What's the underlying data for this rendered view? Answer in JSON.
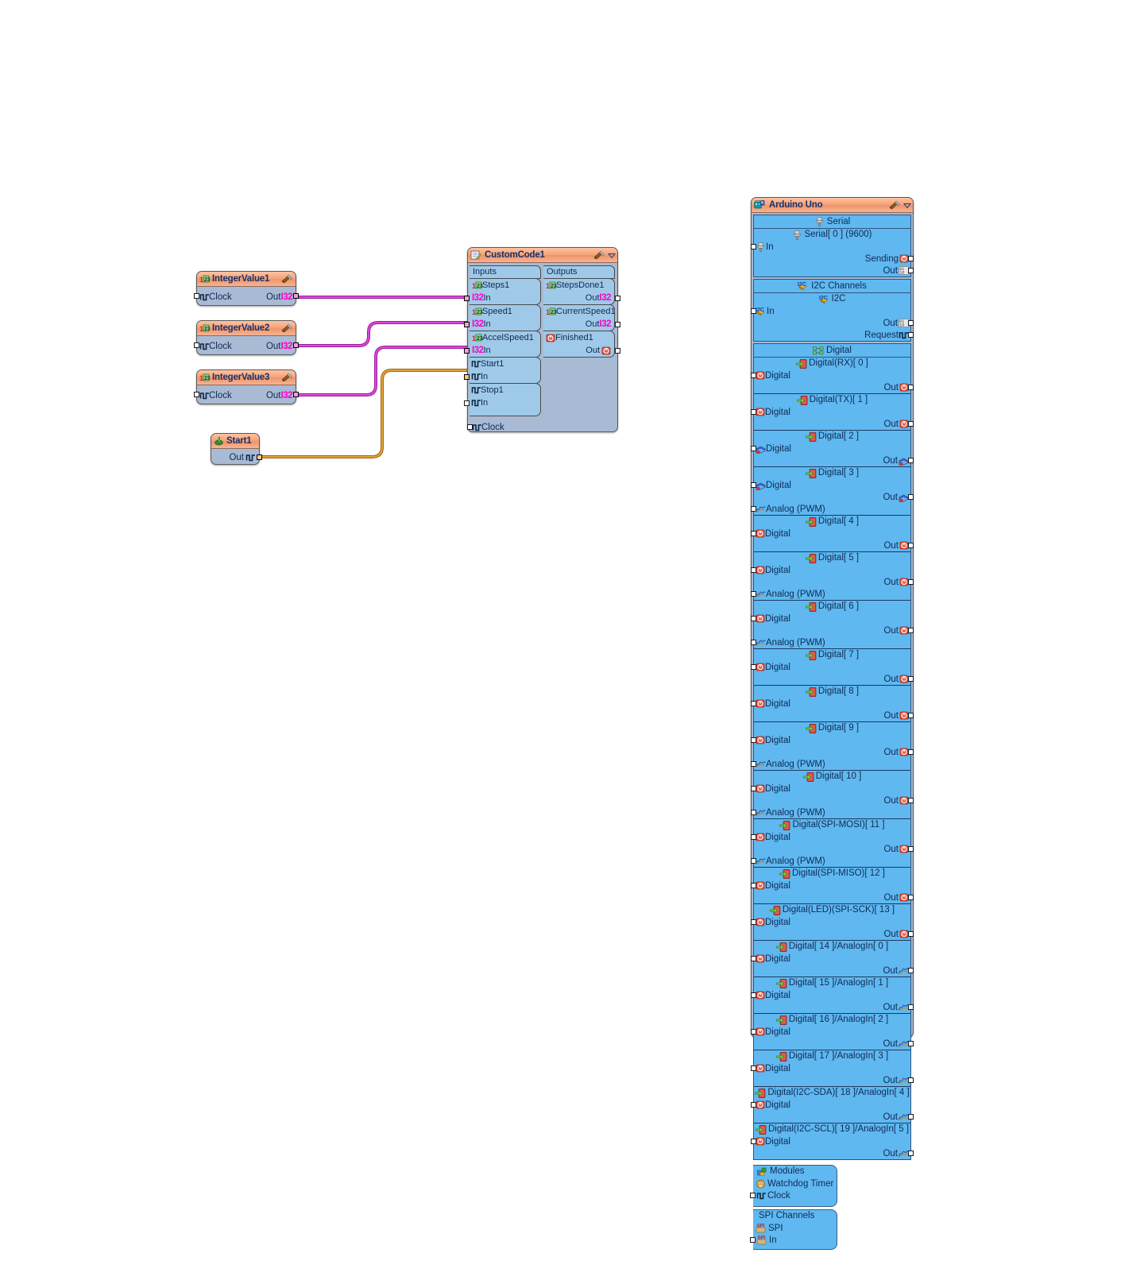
{
  "canvas": {
    "background": "#ffffff",
    "wire_color_data": "#cc2ecc",
    "wire_color_clock": "#c8860d"
  },
  "nodes": {
    "integer_values": [
      {
        "title": "IntegerValue1",
        "input_label": "Clock",
        "output_label": "Out",
        "output_type": "I32",
        "icon": "number-123-icon",
        "tool_icon": "wrench-icon"
      },
      {
        "title": "IntegerValue2",
        "input_label": "Clock",
        "output_label": "Out",
        "output_type": "I32",
        "icon": "number-123-icon",
        "tool_icon": "wrench-icon"
      },
      {
        "title": "IntegerValue3",
        "input_label": "Clock",
        "output_label": "Out",
        "output_type": "I32",
        "icon": "number-123-icon",
        "tool_icon": "wrench-icon"
      }
    ],
    "start": {
      "title": "Start1",
      "output_label": "Out",
      "icon": "start-icon"
    },
    "customcode": {
      "title": "CustomCode1",
      "title_icon": "code-edit-icon",
      "tool_icon": "wrench-icon",
      "menu_icon": "chevron-down-icon",
      "inputs_header": "Inputs",
      "outputs_header": "Outputs",
      "inputs": [
        {
          "name": "Steps1",
          "pin_label": "In",
          "type": "I32",
          "icon": "number-123-icon"
        },
        {
          "name": "Speed1",
          "pin_label": "In",
          "type": "I32",
          "icon": "number-123-icon"
        },
        {
          "name": "AccelSpeed1",
          "pin_label": "In",
          "type": "I32",
          "icon": "number-123-icon"
        },
        {
          "name": "Start1",
          "pin_label": "In",
          "type": "clock",
          "icon": "clock-pulse-icon"
        },
        {
          "name": "Stop1",
          "pin_label": "In",
          "type": "clock",
          "icon": "clock-pulse-icon"
        }
      ],
      "outputs": [
        {
          "name": "StepsDone1",
          "pin_label": "Out",
          "type": "I32",
          "icon": "number-123-icon"
        },
        {
          "name": "CurrentSpeed1",
          "pin_label": "Out",
          "type": "I32",
          "icon": "number-123-icon"
        },
        {
          "name": "Finished1",
          "pin_label": "Out",
          "type": "bool",
          "icon": "boolean-icon"
        }
      ],
      "clock_label": "Clock"
    },
    "arduino": {
      "title": "Arduino Uno",
      "title_icon": "arduino-icon",
      "tool_icon": "wrench-icon",
      "menu_icon": "chevron-down-icon",
      "sections": [
        {
          "header": "Serial",
          "header_icon": "serial-icon",
          "channels": [
            {
              "name": "Serial[ 0 ] (9600)",
              "name_icon": "serial-icon",
              "rows": [
                {
                  "side": "left",
                  "label": "In",
                  "icon": "serial-icon",
                  "pin": true
                },
                {
                  "side": "right",
                  "label": "Sending",
                  "icon": "boolean-icon",
                  "pin": true
                },
                {
                  "side": "right",
                  "label": "Out",
                  "icon": "binary-icon",
                  "pin": true
                }
              ]
            }
          ]
        },
        {
          "header": "I2C Channels",
          "header_icon": "i2c-icon",
          "channels": [
            {
              "name": "I2C",
              "name_icon": "i2c-icon",
              "rows": [
                {
                  "side": "left",
                  "label": "In",
                  "icon": "i2c-icon",
                  "pin": true
                },
                {
                  "side": "right",
                  "label": "Out",
                  "icon": "binary-icon",
                  "pin": true
                },
                {
                  "side": "right",
                  "label": "Request",
                  "icon": "clock-pulse-icon",
                  "pin": true
                }
              ]
            }
          ]
        },
        {
          "header": "Digital",
          "header_icon": "digital-icon",
          "channels": [
            {
              "name": "Digital(RX)[ 0 ]",
              "name_icon": "pin-arrow-icon",
              "rows": [
                {
                  "side": "left",
                  "label": "Digital",
                  "icon": "boolean-icon",
                  "pin": true
                },
                {
                  "side": "right",
                  "label": "Out",
                  "icon": "boolean-icon",
                  "pin": true
                }
              ]
            },
            {
              "name": "Digital(TX)[ 1 ]",
              "name_icon": "pin-arrow-icon",
              "rows": [
                {
                  "side": "left",
                  "label": "Digital",
                  "icon": "boolean-icon",
                  "pin": true
                },
                {
                  "side": "right",
                  "label": "Out",
                  "icon": "boolean-icon",
                  "pin": true
                }
              ]
            },
            {
              "name": "Digital[ 2 ]",
              "name_icon": "pin-arrow-icon",
              "rows": [
                {
                  "side": "left",
                  "label": "Digital",
                  "icon": "books-icon",
                  "pin": true
                },
                {
                  "side": "right",
                  "label": "Out",
                  "icon": "books-icon",
                  "pin": true
                }
              ]
            },
            {
              "name": "Digital[ 3 ]",
              "name_icon": "pin-arrow-icon",
              "rows": [
                {
                  "side": "left",
                  "label": "Digital",
                  "icon": "books-icon",
                  "pin": true
                },
                {
                  "side": "right",
                  "label": "Out",
                  "icon": "books-icon",
                  "pin": true
                },
                {
                  "side": "left",
                  "label": "Analog (PWM)",
                  "icon": "analog-icon",
                  "pin": true
                }
              ]
            },
            {
              "name": "Digital[ 4 ]",
              "name_icon": "pin-arrow-icon",
              "rows": [
                {
                  "side": "left",
                  "label": "Digital",
                  "icon": "boolean-icon",
                  "pin": true
                },
                {
                  "side": "right",
                  "label": "Out",
                  "icon": "boolean-icon",
                  "pin": true
                }
              ]
            },
            {
              "name": "Digital[ 5 ]",
              "name_icon": "pin-arrow-icon",
              "rows": [
                {
                  "side": "left",
                  "label": "Digital",
                  "icon": "boolean-icon",
                  "pin": true
                },
                {
                  "side": "right",
                  "label": "Out",
                  "icon": "boolean-icon",
                  "pin": true
                },
                {
                  "side": "left",
                  "label": "Analog (PWM)",
                  "icon": "analog-icon",
                  "pin": true
                }
              ]
            },
            {
              "name": "Digital[ 6 ]",
              "name_icon": "pin-arrow-icon",
              "rows": [
                {
                  "side": "left",
                  "label": "Digital",
                  "icon": "boolean-icon",
                  "pin": true
                },
                {
                  "side": "right",
                  "label": "Out",
                  "icon": "boolean-icon",
                  "pin": true
                },
                {
                  "side": "left",
                  "label": "Analog (PWM)",
                  "icon": "analog-icon",
                  "pin": true
                }
              ]
            },
            {
              "name": "Digital[ 7 ]",
              "name_icon": "pin-arrow-icon",
              "rows": [
                {
                  "side": "left",
                  "label": "Digital",
                  "icon": "boolean-icon",
                  "pin": true
                },
                {
                  "side": "right",
                  "label": "Out",
                  "icon": "boolean-icon",
                  "pin": true
                }
              ]
            },
            {
              "name": "Digital[ 8 ]",
              "name_icon": "pin-arrow-icon",
              "rows": [
                {
                  "side": "left",
                  "label": "Digital",
                  "icon": "boolean-icon",
                  "pin": true
                },
                {
                  "side": "right",
                  "label": "Out",
                  "icon": "boolean-icon",
                  "pin": true
                }
              ]
            },
            {
              "name": "Digital[ 9 ]",
              "name_icon": "pin-arrow-icon",
              "rows": [
                {
                  "side": "left",
                  "label": "Digital",
                  "icon": "boolean-icon",
                  "pin": true
                },
                {
                  "side": "right",
                  "label": "Out",
                  "icon": "boolean-icon",
                  "pin": true
                },
                {
                  "side": "left",
                  "label": "Analog (PWM)",
                  "icon": "analog-icon",
                  "pin": true
                }
              ]
            },
            {
              "name": "Digital[ 10 ]",
              "name_icon": "pin-arrow-icon",
              "rows": [
                {
                  "side": "left",
                  "label": "Digital",
                  "icon": "boolean-icon",
                  "pin": true
                },
                {
                  "side": "right",
                  "label": "Out",
                  "icon": "boolean-icon",
                  "pin": true
                },
                {
                  "side": "left",
                  "label": "Analog (PWM)",
                  "icon": "analog-icon",
                  "pin": true
                }
              ]
            },
            {
              "name": "Digital(SPI-MOSI)[ 11 ]",
              "name_icon": "pin-arrow-icon",
              "rows": [
                {
                  "side": "left",
                  "label": "Digital",
                  "icon": "boolean-icon",
                  "pin": true
                },
                {
                  "side": "right",
                  "label": "Out",
                  "icon": "boolean-icon",
                  "pin": true
                },
                {
                  "side": "left",
                  "label": "Analog (PWM)",
                  "icon": "analog-icon",
                  "pin": true
                }
              ]
            },
            {
              "name": "Digital(SPI-MISO)[ 12 ]",
              "name_icon": "pin-arrow-icon",
              "rows": [
                {
                  "side": "left",
                  "label": "Digital",
                  "icon": "boolean-icon",
                  "pin": true
                },
                {
                  "side": "right",
                  "label": "Out",
                  "icon": "boolean-icon",
                  "pin": true
                }
              ]
            },
            {
              "name": "Digital(LED)(SPI-SCK)[ 13 ]",
              "name_icon": "pin-arrow-icon",
              "rows": [
                {
                  "side": "left",
                  "label": "Digital",
                  "icon": "boolean-icon",
                  "pin": true
                },
                {
                  "side": "right",
                  "label": "Out",
                  "icon": "boolean-icon",
                  "pin": true
                }
              ]
            },
            {
              "name": "Digital[ 14 ]/AnalogIn[ 0 ]",
              "name_icon": "pin-arrow-icon",
              "rows": [
                {
                  "side": "left",
                  "label": "Digital",
                  "icon": "boolean-icon",
                  "pin": true
                },
                {
                  "side": "right",
                  "label": "Out",
                  "icon": "analog-icon",
                  "pin": true
                }
              ]
            },
            {
              "name": "Digital[ 15 ]/AnalogIn[ 1 ]",
              "name_icon": "pin-arrow-icon",
              "rows": [
                {
                  "side": "left",
                  "label": "Digital",
                  "icon": "boolean-icon",
                  "pin": true
                },
                {
                  "side": "right",
                  "label": "Out",
                  "icon": "analog-icon",
                  "pin": true
                }
              ]
            },
            {
              "name": "Digital[ 16 ]/AnalogIn[ 2 ]",
              "name_icon": "pin-arrow-icon",
              "rows": [
                {
                  "side": "left",
                  "label": "Digital",
                  "icon": "boolean-icon",
                  "pin": true
                },
                {
                  "side": "right",
                  "label": "Out",
                  "icon": "analog-icon",
                  "pin": true
                }
              ]
            },
            {
              "name": "Digital[ 17 ]/AnalogIn[ 3 ]",
              "name_icon": "pin-arrow-icon",
              "rows": [
                {
                  "side": "left",
                  "label": "Digital",
                  "icon": "boolean-icon",
                  "pin": true
                },
                {
                  "side": "right",
                  "label": "Out",
                  "icon": "analog-icon",
                  "pin": true
                }
              ]
            },
            {
              "name": "Digital(I2C-SDA)[ 18 ]/AnalogIn[ 4 ]",
              "name_icon": "pin-arrow-icon",
              "rows": [
                {
                  "side": "left",
                  "label": "Digital",
                  "icon": "boolean-icon",
                  "pin": true
                },
                {
                  "side": "right",
                  "label": "Out",
                  "icon": "analog-icon",
                  "pin": true
                }
              ]
            },
            {
              "name": "Digital(I2C-SCL)[ 19 ]/AnalogIn[ 5 ]",
              "name_icon": "pin-arrow-icon",
              "rows": [
                {
                  "side": "left",
                  "label": "Digital",
                  "icon": "boolean-icon",
                  "pin": true
                },
                {
                  "side": "right",
                  "label": "Out",
                  "icon": "analog-icon",
                  "pin": true
                }
              ]
            }
          ]
        }
      ],
      "modules_panel": {
        "header": "Modules",
        "header_icon": "modules-icon",
        "item": "Watchdog Timer",
        "item_icon": "watchdog-icon",
        "clock_label": "Clock",
        "clock_icon": "clock-pulse-icon"
      },
      "spi_panel": {
        "header": "SPI Channels",
        "item": "SPI",
        "item_icon": "spi-icon",
        "in_label": "In",
        "in_icon": "spi-icon"
      }
    }
  },
  "connections": [
    {
      "from": "IntegerValue1.Out",
      "to": "CustomCode1.Steps1.In",
      "color": "#cc2ecc"
    },
    {
      "from": "IntegerValue2.Out",
      "to": "CustomCode1.Speed1.In",
      "color": "#cc2ecc"
    },
    {
      "from": "IntegerValue3.Out",
      "to": "CustomCode1.AccelSpeed1.In",
      "color": "#cc2ecc"
    },
    {
      "from": "Start1.Out",
      "to": "CustomCode1.Start1.In",
      "color": "#c8860d"
    }
  ]
}
